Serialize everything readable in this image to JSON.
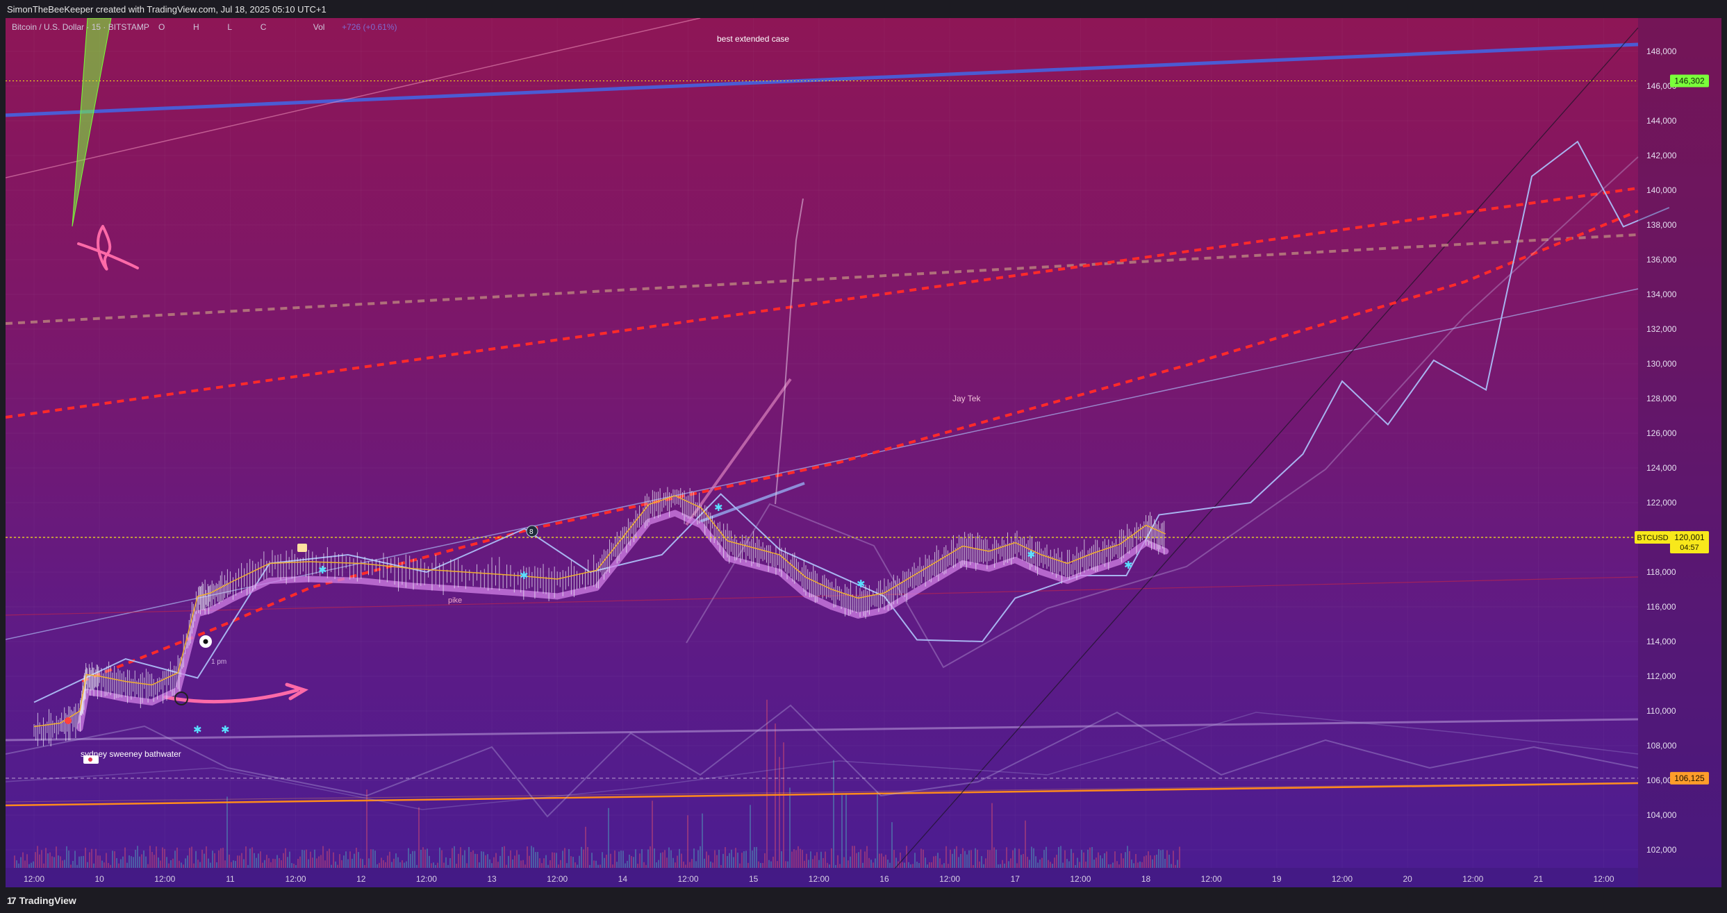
{
  "header": {
    "attribution": "SimonTheBeeKeeper created with TradingView.com, Jul 18, 2025 05:10 UTC+1"
  },
  "legend": {
    "symbol": "Bitcoin / U.S. Dollar · 15 · BITSTAMP",
    "o_label": "O",
    "h_label": "H",
    "l_label": "L",
    "c_label": "C",
    "vol_label": "Vol",
    "change": "+726 (+0.61%)"
  },
  "price_badges": {
    "level_top": "146,302",
    "ticker": "BTCUSD",
    "last_price": "120,001",
    "countdown": "04:57",
    "level_bottom": "106,125"
  },
  "annotations": {
    "best_case": "best extended case",
    "jay_tek": "Jay Tek",
    "pike": "pike",
    "sydney": "sydney sweeney bathwater",
    "pill_label": "1 pm"
  },
  "footer": {
    "brand": "TradingView"
  },
  "colors": {
    "background_top": "#8e1656",
    "background_bottom": "#4a1c92",
    "trendline_blue": "#4b5bd4",
    "dashed_red": "#ff2a2a",
    "dashed_brown": "#b0707a",
    "projection_lightblue": "#a8b4f0",
    "orange_line": "#ff8a1c",
    "highlight_green": "#7aff3a",
    "highlight_yellow": "#f8e81b"
  },
  "chart_data": {
    "type": "line",
    "title": "",
    "xlabel": "",
    "ylabel": "",
    "ylim": [
      101000,
      149000
    ],
    "y_ticks": [
      102000,
      104000,
      106000,
      108000,
      110000,
      112000,
      114000,
      116000,
      118000,
      120000,
      122000,
      124000,
      126000,
      128000,
      130000,
      132000,
      134000,
      136000,
      138000,
      140000,
      142000,
      144000,
      146000,
      148000
    ],
    "y_tick_labels": [
      "102,000",
      "104,000",
      "106,000",
      "108,000",
      "110,000",
      "112,000",
      "114,000",
      "116,000",
      "118,000",
      "120,000",
      "122,000",
      "124,000",
      "126,000",
      "128,000",
      "130,000",
      "132,000",
      "134,000",
      "136,000",
      "138,000",
      "140,000",
      "142,000",
      "144,000",
      "146,000",
      "148,000"
    ],
    "x_range_days": [
      9.5,
      22.05
    ],
    "x_ticks": [
      {
        "day": 9.5,
        "label": "12:00"
      },
      {
        "day": 10,
        "label": "10"
      },
      {
        "day": 10.5,
        "label": "12:00"
      },
      {
        "day": 11,
        "label": "11"
      },
      {
        "day": 11.5,
        "label": "12:00"
      },
      {
        "day": 12,
        "label": "12"
      },
      {
        "day": 12.5,
        "label": "12:00"
      },
      {
        "day": 13,
        "label": "13"
      },
      {
        "day": 13.5,
        "label": "12:00"
      },
      {
        "day": 14,
        "label": "14"
      },
      {
        "day": 14.5,
        "label": "12:00"
      },
      {
        "day": 15,
        "label": "15"
      },
      {
        "day": 15.5,
        "label": "12:00"
      },
      {
        "day": 16,
        "label": "16"
      },
      {
        "day": 16.5,
        "label": "12:00"
      },
      {
        "day": 17,
        "label": "17"
      },
      {
        "day": 17.5,
        "label": "12:00"
      },
      {
        "day": 18,
        "label": "18"
      },
      {
        "day": 18.5,
        "label": "12:00"
      },
      {
        "day": 19,
        "label": "19"
      },
      {
        "day": 19.5,
        "label": "12:00"
      },
      {
        "day": 20,
        "label": "20"
      },
      {
        "day": 20.5,
        "label": "12:00"
      },
      {
        "day": 21,
        "label": "21"
      },
      {
        "day": 21.5,
        "label": "12:00"
      }
    ],
    "price_series": {
      "name": "BTCUSD",
      "points": [
        [
          9.5,
          108900
        ],
        [
          9.7,
          109100
        ],
        [
          9.85,
          109800
        ],
        [
          9.9,
          111900
        ],
        [
          10.0,
          111800
        ],
        [
          10.2,
          111500
        ],
        [
          10.4,
          111300
        ],
        [
          10.6,
          112000
        ],
        [
          10.75,
          116400
        ],
        [
          10.85,
          116600
        ],
        [
          11.0,
          117200
        ],
        [
          11.3,
          118300
        ],
        [
          11.6,
          118400
        ],
        [
          12.0,
          118300
        ],
        [
          12.4,
          118000
        ],
        [
          12.8,
          117800
        ],
        [
          13.2,
          117600
        ],
        [
          13.5,
          117400
        ],
        [
          13.8,
          117900
        ],
        [
          14.0,
          119800
        ],
        [
          14.2,
          121700
        ],
        [
          14.4,
          122200
        ],
        [
          14.6,
          121500
        ],
        [
          14.8,
          119600
        ],
        [
          15.0,
          119200
        ],
        [
          15.2,
          118800
        ],
        [
          15.4,
          117500
        ],
        [
          15.6,
          116800
        ],
        [
          15.8,
          116300
        ],
        [
          16.0,
          116600
        ],
        [
          16.2,
          117500
        ],
        [
          16.4,
          118400
        ],
        [
          16.6,
          119300
        ],
        [
          16.8,
          119000
        ],
        [
          17.0,
          119500
        ],
        [
          17.2,
          118800
        ],
        [
          17.4,
          118300
        ],
        [
          17.6,
          118900
        ],
        [
          17.8,
          119400
        ],
        [
          18.0,
          120500
        ],
        [
          18.15,
          120001
        ]
      ]
    },
    "projection_series": {
      "name": "",
      "points": [
        [
          9.5,
          110500
        ],
        [
          10.2,
          113000
        ],
        [
          10.75,
          111900
        ],
        [
          11.3,
          118500
        ],
        [
          11.9,
          119000
        ],
        [
          12.5,
          118000
        ],
        [
          13.25,
          120500
        ],
        [
          13.75,
          118000
        ],
        [
          14.3,
          119000
        ],
        [
          14.75,
          122500
        ],
        [
          15.2,
          119300
        ],
        [
          16.0,
          116600
        ],
        [
          16.25,
          114100
        ],
        [
          16.75,
          114000
        ],
        [
          17.0,
          116500
        ],
        [
          17.5,
          117800
        ],
        [
          17.85,
          117800
        ],
        [
          18.1,
          121300
        ],
        [
          18.6,
          121800
        ],
        [
          18.8,
          122000
        ],
        [
          19.2,
          124800
        ],
        [
          19.5,
          129000
        ],
        [
          19.85,
          126500
        ],
        [
          20.2,
          130200
        ],
        [
          20.6,
          128500
        ],
        [
          20.95,
          140800
        ],
        [
          21.3,
          142800
        ],
        [
          21.65,
          137900
        ],
        [
          22.0,
          139000
        ]
      ]
    },
    "horizontal_levels": [
      {
        "label": "146,302",
        "value": 146302
      },
      {
        "label": "BTCUSD",
        "value": 120001
      },
      {
        "label": "106,125",
        "value": 106125
      }
    ]
  }
}
